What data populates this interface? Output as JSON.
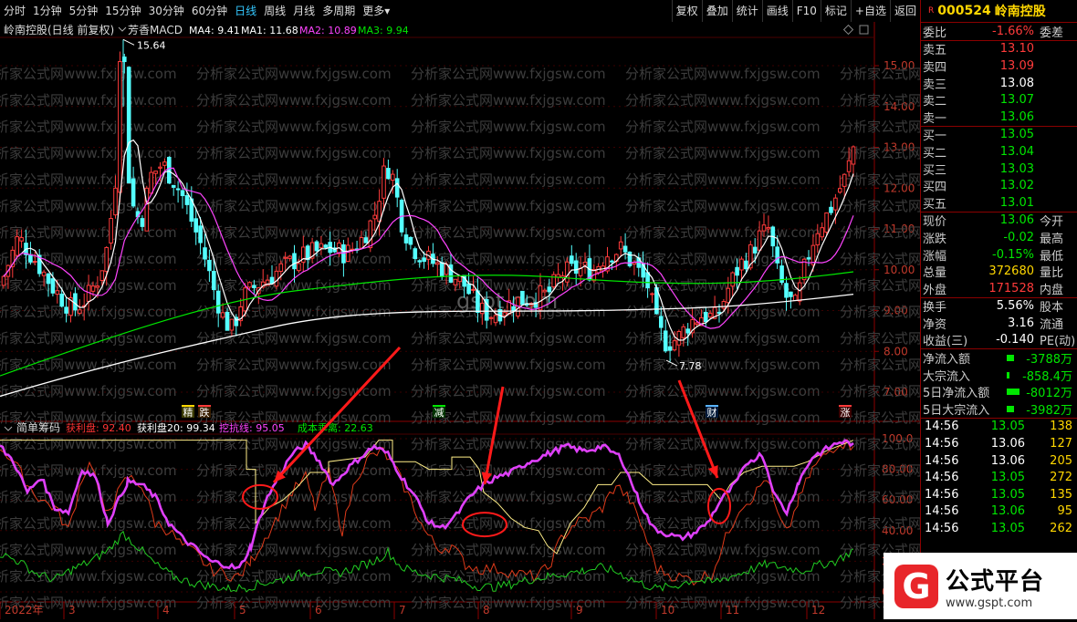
{
  "toolbar": {
    "periods": [
      "分时",
      "1分钟",
      "5分钟",
      "15分钟",
      "30分钟",
      "60分钟",
      "日线",
      "周线",
      "月线",
      "多周期",
      "更多▾"
    ],
    "active": "日线",
    "right": [
      "复权",
      "叠加",
      "统计",
      "画线",
      "F10",
      "标记",
      "+自选",
      "返回"
    ]
  },
  "main": {
    "title": "岭南控股(日线 前复权)",
    "indicator": "芳香MACD",
    "ma": [
      {
        "label": "MA4: 9.41",
        "color": "#ffffff"
      },
      {
        "label": "MA1: 11.68",
        "color": "#ffffff"
      },
      {
        "label": "MA2: 10.89",
        "color": "#ff44ff"
      },
      {
        "label": "MA3: 9.94",
        "color": "#00e600"
      }
    ],
    "high_label": "15.64",
    "low_label": "7.78",
    "price_ticks": [
      "15.00",
      "14.00",
      "13.00",
      "12.00",
      "11.00",
      "10.00",
      "9.00",
      "8.00",
      "7.00"
    ],
    "markers": [
      "精",
      "跌",
      "减",
      "财",
      "涨"
    ]
  },
  "sub": {
    "title": "简单筹码",
    "labels": [
      {
        "text": "获利盘: 92.40",
        "color": "#ff3333"
      },
      {
        "text": "获利盘20: 99.34",
        "color": "#ffffff"
      },
      {
        "text": "挖抗线: 95.05",
        "color": "#ff44ff"
      },
      {
        "text": "成本乖离: 22.63",
        "color": "#00e600"
      }
    ],
    "ticks": [
      "100.0",
      "80.00",
      "60.00",
      "40.00",
      "20.00",
      "0.00"
    ]
  },
  "xaxis": [
    "2022年",
    "3",
    "4",
    "5",
    "6",
    "7",
    "8",
    "9",
    "10",
    "11",
    "12"
  ],
  "watermark": "分析家公式网www.fxjgsw.com",
  "watermark2": "gspt.com",
  "stock": {
    "code": "000524",
    "name": "岭南控股"
  },
  "quote": {
    "weibi": {
      "label": "委比",
      "value": "-1.66%",
      "label2": "委差"
    },
    "sell": [
      {
        "l": "卖五",
        "p": "13.10"
      },
      {
        "l": "卖四",
        "p": "13.09"
      },
      {
        "l": "卖三",
        "p": "13.08"
      },
      {
        "l": "卖二",
        "p": "13.07"
      },
      {
        "l": "卖一",
        "p": "13.06"
      }
    ],
    "buy": [
      {
        "l": "买一",
        "p": "13.05"
      },
      {
        "l": "买二",
        "p": "13.04"
      },
      {
        "l": "买三",
        "p": "13.03"
      },
      {
        "l": "买四",
        "p": "13.02"
      },
      {
        "l": "买五",
        "p": "13.01"
      }
    ],
    "info": [
      {
        "l": "现价",
        "v": "13.06",
        "l2": "今开"
      },
      {
        "l": "涨跌",
        "v": "-0.02",
        "l2": "最高"
      },
      {
        "l": "涨幅",
        "v": "-0.15%",
        "l2": "最低"
      },
      {
        "l": "总量",
        "v": "372680",
        "l2": "量比"
      },
      {
        "l": "外盘",
        "v": "171528",
        "l2": "内盘"
      }
    ],
    "info2": [
      {
        "l": "换手",
        "v": "5.56%",
        "l2": "股本"
      },
      {
        "l": "净资",
        "v": "3.16",
        "l2": "流通"
      },
      {
        "l": "收益(三)",
        "v": "-0.140",
        "l2": "PE(动)"
      }
    ],
    "flows": [
      {
        "l": "净流入额",
        "v": "-3788万"
      },
      {
        "l": "大宗流入",
        "v": "-858.4万"
      },
      {
        "l": "5日净流入额",
        "v": "-8012万"
      },
      {
        "l": "5日大宗流入",
        "v": "-3982万"
      }
    ],
    "ticks": [
      {
        "t": "14:56",
        "p": "13.05",
        "v": "138"
      },
      {
        "t": "14:56",
        "p": "13.06",
        "v": "127"
      },
      {
        "t": "14:56",
        "p": "13.06",
        "v": "205"
      },
      {
        "t": "14:56",
        "p": "13.05",
        "v": "272"
      },
      {
        "t": "14:56",
        "p": "13.05",
        "v": "135"
      },
      {
        "t": "14:56",
        "p": "13.06",
        "v": "95"
      },
      {
        "t": "14:56",
        "p": "13.05",
        "v": "262"
      }
    ]
  },
  "logo": {
    "mark": "G",
    "title": "公式平台",
    "url": "www.gspt.com"
  }
}
